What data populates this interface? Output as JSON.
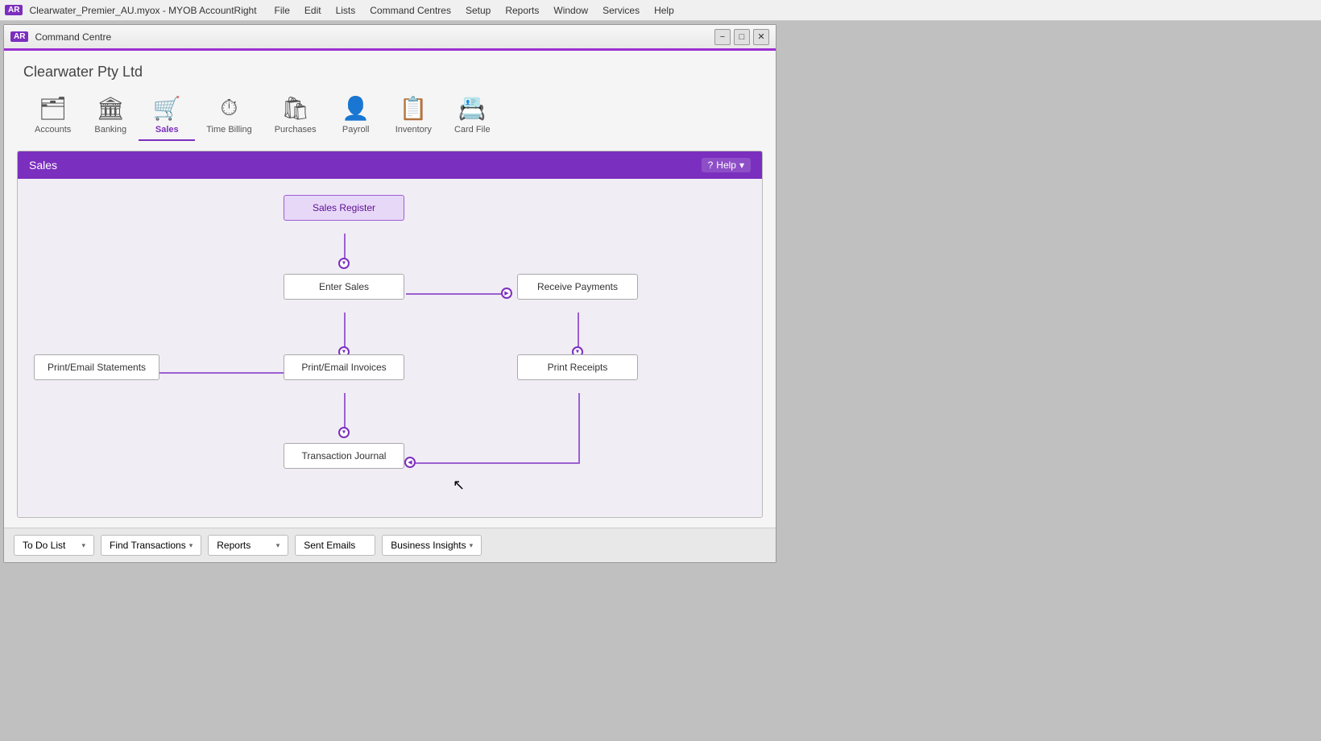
{
  "app": {
    "icon": "AR",
    "title": "Clearwater_Premier_AU.myox - MYOB AccountRight"
  },
  "menubar": {
    "items": [
      "File",
      "Edit",
      "Lists",
      "Command Centres",
      "Setup",
      "Reports",
      "Window",
      "Services",
      "Help"
    ]
  },
  "window": {
    "title": "Command Centre",
    "minimize": "−",
    "restore": "□",
    "close": "✕"
  },
  "company": {
    "name": "Clearwater Pty Ltd"
  },
  "modules": [
    {
      "id": "accounts",
      "label": "Accounts",
      "icon": "🗂"
    },
    {
      "id": "banking",
      "label": "Banking",
      "icon": "🏛"
    },
    {
      "id": "sales",
      "label": "Sales",
      "icon": "🛒",
      "active": true
    },
    {
      "id": "time-billing",
      "label": "Time Billing",
      "icon": "⏱"
    },
    {
      "id": "purchases",
      "label": "Purchases",
      "icon": "🛍"
    },
    {
      "id": "payroll",
      "label": "Payroll",
      "icon": "👤"
    },
    {
      "id": "inventory",
      "label": "Inventory",
      "icon": "📋"
    },
    {
      "id": "card-file",
      "label": "Card File",
      "icon": "📇"
    }
  ],
  "sales_panel": {
    "title": "Sales",
    "help_label": "Help"
  },
  "flow": {
    "nodes": [
      {
        "id": "sales-register",
        "label": "Sales Register"
      },
      {
        "id": "enter-sales",
        "label": "Enter Sales"
      },
      {
        "id": "receive-payments",
        "label": "Receive Payments"
      },
      {
        "id": "print-email-statements",
        "label": "Print/Email Statements"
      },
      {
        "id": "print-email-invoices",
        "label": "Print/Email Invoices"
      },
      {
        "id": "print-receipts",
        "label": "Print Receipts"
      },
      {
        "id": "transaction-journal",
        "label": "Transaction Journal"
      }
    ]
  },
  "toolbar": {
    "buttons": [
      {
        "id": "to-do-list",
        "label": "To Do List"
      },
      {
        "id": "find-transactions",
        "label": "Find Transactions"
      },
      {
        "id": "reports",
        "label": "Reports"
      },
      {
        "id": "sent-emails",
        "label": "Sent Emails"
      },
      {
        "id": "business-insights",
        "label": "Business Insights"
      }
    ]
  }
}
